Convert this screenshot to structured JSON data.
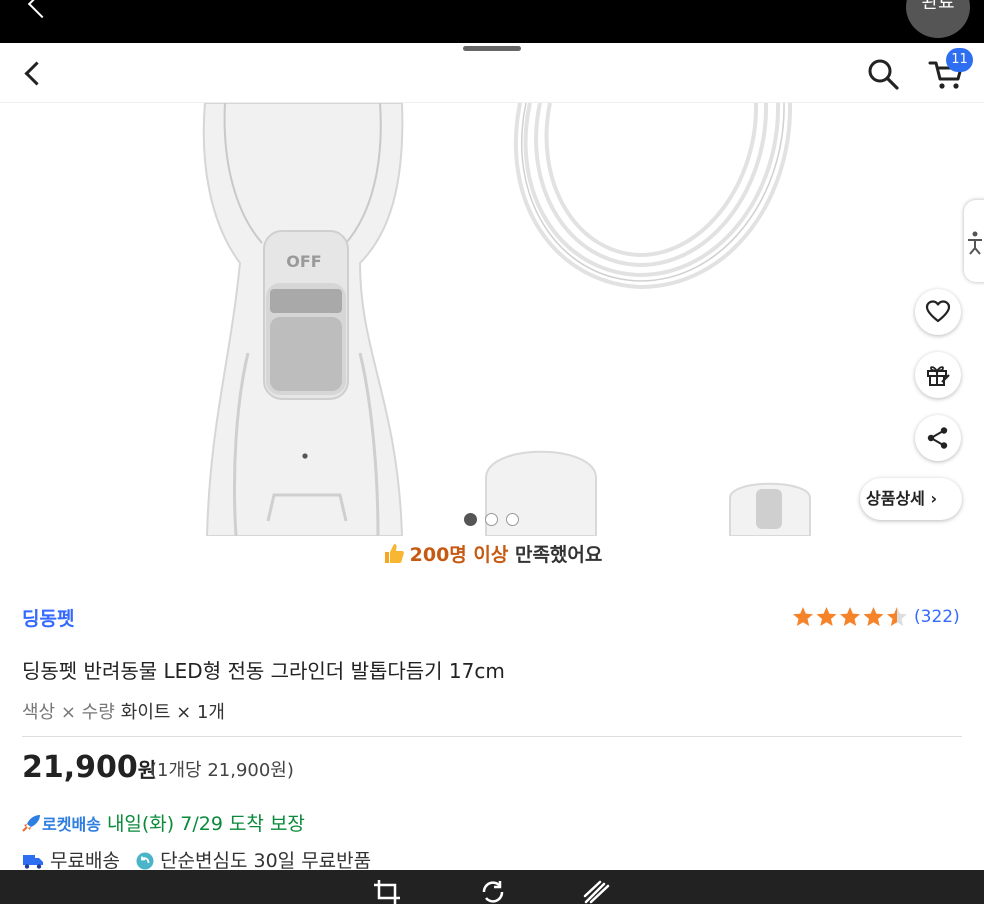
{
  "topbar": {
    "done_label": "완료"
  },
  "header": {
    "cart_count": "11"
  },
  "gallery": {
    "switch_label": "OFF",
    "page_count": 3,
    "current_page": 1
  },
  "side_actions": {
    "detail_label": "상품상세 ›"
  },
  "banner": {
    "highlight": "200명 이상",
    "text": "만족했어요"
  },
  "product": {
    "brand": "딩동펫",
    "title": "딩동펫 반려동물 LED형 전동 그라인더 발톱다듬기 17cm",
    "rating": 4.5,
    "review_count": "(322)",
    "option_label": "색상 × 수량",
    "option_value": "화이트 × 1개",
    "price": "21,900",
    "price_unit": "원",
    "unit_price": "(1개당 21,900원)"
  },
  "delivery": {
    "rocket_label": "로켓배송",
    "rocket_text": "내일(화) 7/29 도착 보장",
    "free_shipping": "무료배송",
    "return_policy": "단순변심도 30일 무료반품"
  },
  "colors": {
    "accent": "#346aff",
    "highlight": "#c65a12",
    "rocket_green": "#0a8a3a",
    "star": "#f5832a"
  }
}
